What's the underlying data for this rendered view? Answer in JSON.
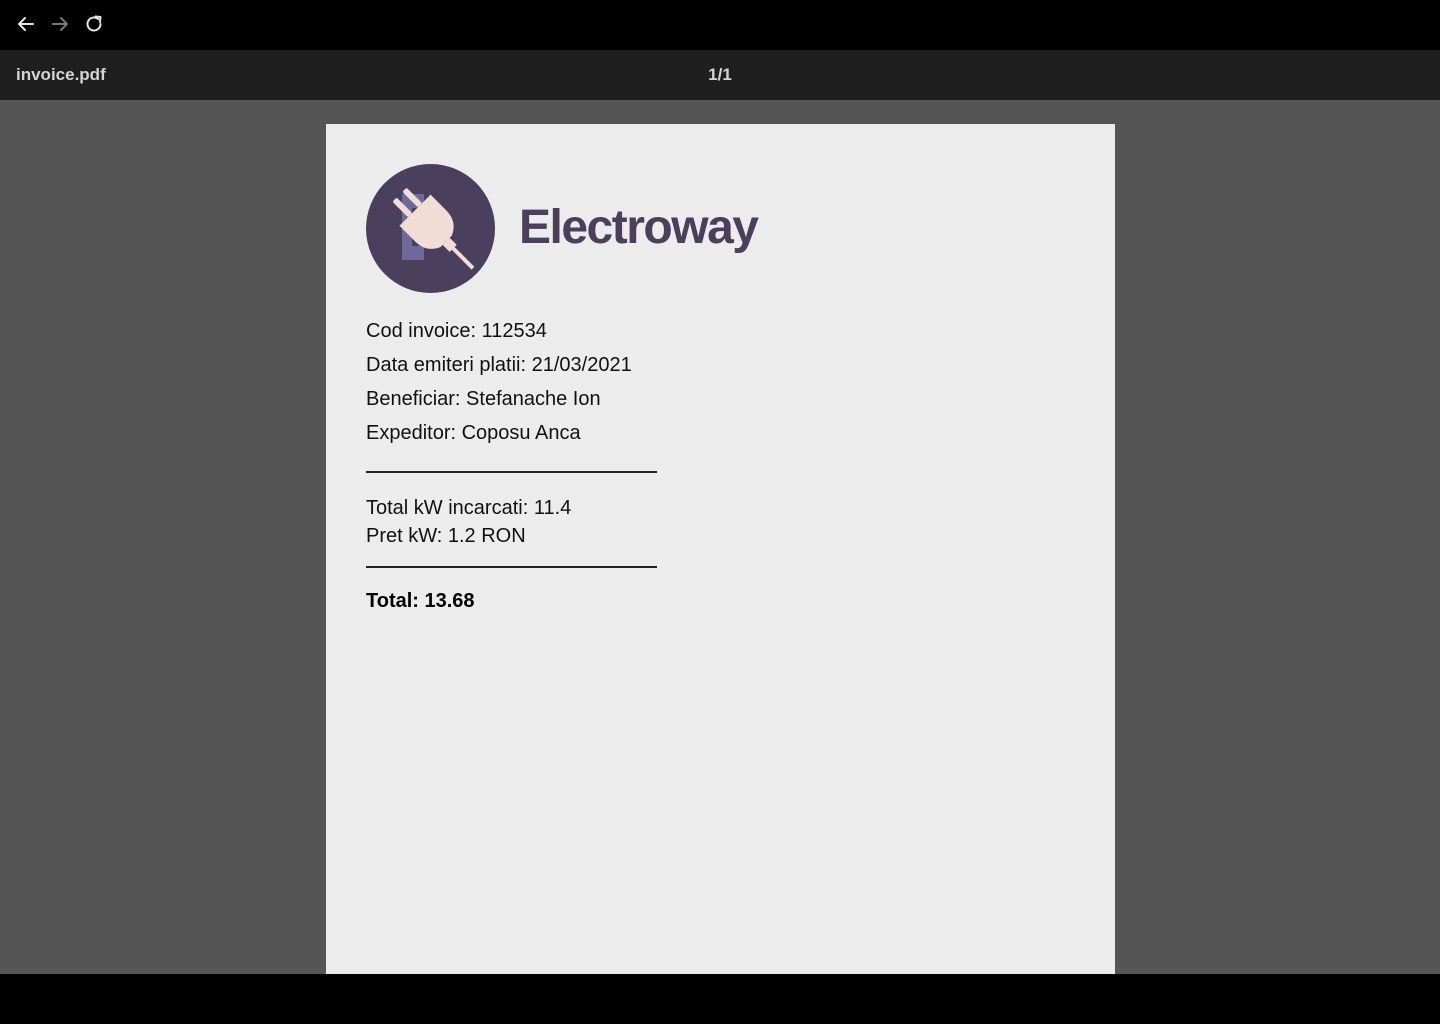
{
  "browser": {
    "back_icon": "arrow-left-icon",
    "forward_icon": "arrow-right-icon",
    "reload_icon": "reload-icon"
  },
  "viewer": {
    "file_name": "invoice.pdf",
    "page_indicator": "1/1"
  },
  "invoice": {
    "brand": "Electroway",
    "logo_icon": "plug-icon",
    "code": "Cod invoice: 112534",
    "issue_date": "Data emiteri platii: 21/03/2021",
    "beneficiary": "Beneficiar: Stefanache Ion",
    "sender": "Expeditor: Coposu Anca",
    "kw_total": "Total kW incarcati: 11.4",
    "kw_price": "Pret kW: 1.2 RON",
    "total": "Total: 13.68"
  },
  "colors": {
    "toolbar": "#1f1f1f",
    "viewer_bg": "#555555",
    "page_bg": "#ececec",
    "brand": "#4a3f5c",
    "logo_circle": "#4a3f5c",
    "plug": "#f2dcd6"
  }
}
